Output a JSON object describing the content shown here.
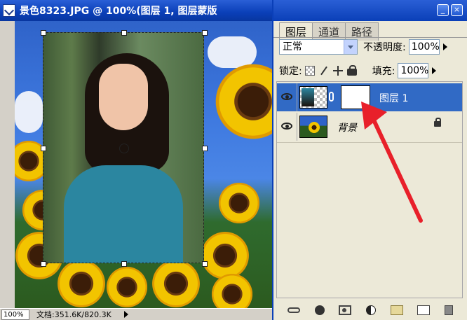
{
  "document": {
    "title": "景色8323.JPG @ 100%(图层 1, 图层蒙版",
    "zoom": "100%",
    "doc_size": "文档:351.6K/820.3K"
  },
  "layers_panel": {
    "tabs": [
      "图层",
      "通道",
      "路径"
    ],
    "active_tab": "图层",
    "blend_mode": "正常",
    "opacity_label": "不透明度:",
    "opacity_value": "100%",
    "lock_label": "锁定:",
    "fill_label": "填充:",
    "fill_value": "100%",
    "layers": [
      {
        "name": "图层 1",
        "selected": true,
        "has_mask": true
      },
      {
        "name": "背景",
        "selected": false,
        "locked": true
      }
    ]
  },
  "colors": {
    "selection": "#316ac5",
    "title_bar": "#0a3fb8",
    "annotation_arrow": "#e8202a"
  }
}
